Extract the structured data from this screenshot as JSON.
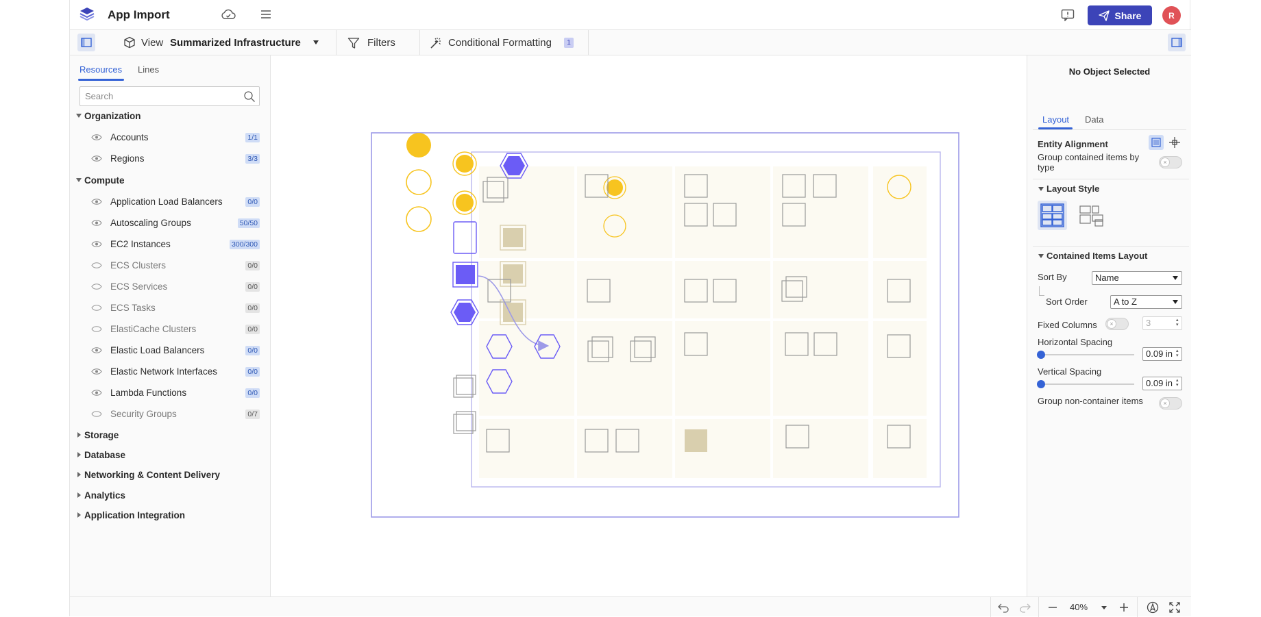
{
  "header": {
    "app_title": "App Import",
    "share_label": "Share",
    "avatar_initial": "R"
  },
  "toolbar": {
    "view_label": "View",
    "view_name": "Summarized Infrastructure",
    "filters_label": "Filters",
    "conditional_formatting_label": "Conditional Formatting",
    "conditional_formatting_count": "1"
  },
  "left_panel": {
    "tabs": {
      "resources": "Resources",
      "lines": "Lines"
    },
    "search_placeholder": "Search",
    "groups": {
      "organization": {
        "label": "Organization",
        "items": [
          {
            "label": "Accounts",
            "count": "1/1"
          },
          {
            "label": "Regions",
            "count": "3/3"
          }
        ]
      },
      "compute": {
        "label": "Compute",
        "items": [
          {
            "label": "Application Load Balancers",
            "count": "0/0"
          },
          {
            "label": "Autoscaling Groups",
            "count": "50/50"
          },
          {
            "label": "EC2 Instances",
            "count": "300/300"
          },
          {
            "label": "ECS Clusters",
            "count": "0/0"
          },
          {
            "label": "ECS Services",
            "count": "0/0"
          },
          {
            "label": "ECS Tasks",
            "count": "0/0"
          },
          {
            "label": "ElastiCache Clusters",
            "count": "0/0"
          },
          {
            "label": "Elastic Load Balancers",
            "count": "0/0"
          },
          {
            "label": "Elastic Network Interfaces",
            "count": "0/0"
          },
          {
            "label": "Lambda Functions",
            "count": "0/0"
          },
          {
            "label": "Security Groups",
            "count": "0/7"
          }
        ]
      },
      "collapsed": [
        "Storage",
        "Database",
        "Networking & Content Delivery",
        "Analytics",
        "Application Integration"
      ]
    }
  },
  "right_panel": {
    "title": "No Object Selected",
    "tabs": {
      "layout": "Layout",
      "data": "Data"
    },
    "entity_alignment": "Entity Alignment",
    "group_contained": "Group contained items by type",
    "layout_style": "Layout Style",
    "contained_items_layout": "Contained Items Layout",
    "sort_by_label": "Sort By",
    "sort_by_value": "Name",
    "sort_order_label": "Sort Order",
    "sort_order_value": "A to Z",
    "fixed_columns_label": "Fixed Columns",
    "fixed_columns_value": "3",
    "horizontal_spacing_label": "Horizontal Spacing",
    "horizontal_spacing_value": "0.09 in",
    "horizontal_spacing_level": 0,
    "vertical_spacing_label": "Vertical Spacing",
    "vertical_spacing_value": "0.09 in",
    "vertical_spacing_level": 0,
    "group_noncontainer": "Group non-container items"
  },
  "bottombar": {
    "zoom": "40%"
  },
  "colors": {
    "accent": "#3563d6",
    "share_button": "#3c44b8",
    "avatar": "#e05257",
    "region_border": "#9d9ae8",
    "yellow": "#f7c41f",
    "purple": "#6b5cf6",
    "tan": "#d9cfae",
    "cell_bg": "#fcfaf2"
  },
  "icons": [
    "logo-icon",
    "cloud-icon",
    "menu-icon",
    "feedback-icon",
    "send-icon",
    "sidebar-icon",
    "cube-icon",
    "filter-icon",
    "wand-icon",
    "search-icon",
    "eye-icon",
    "undo-icon",
    "redo-icon",
    "zoom-out-icon",
    "zoom-in-icon",
    "navigate-icon",
    "fullscreen-icon"
  ]
}
